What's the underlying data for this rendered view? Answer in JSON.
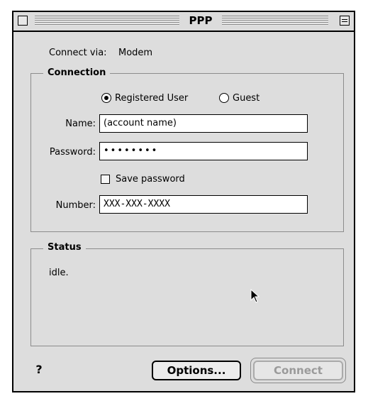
{
  "window": {
    "title": "PPP"
  },
  "connect_via": {
    "label": "Connect via:",
    "value": "Modem"
  },
  "connection": {
    "legend": "Connection",
    "radio_registered": "Registered User",
    "radio_guest": "Guest",
    "selected": "Registered User",
    "name_label": "Name:",
    "name_value": "(account name)",
    "password_label": "Password:",
    "password_value": "••••••••",
    "save_password_label": "Save password",
    "save_password_checked": false,
    "number_label": "Number:",
    "number_value": "XXX-XXX-XXXX"
  },
  "status": {
    "legend": "Status",
    "text": "idle."
  },
  "buttons": {
    "options": "Options...",
    "connect": "Connect"
  },
  "help": {
    "glyph": "?"
  }
}
